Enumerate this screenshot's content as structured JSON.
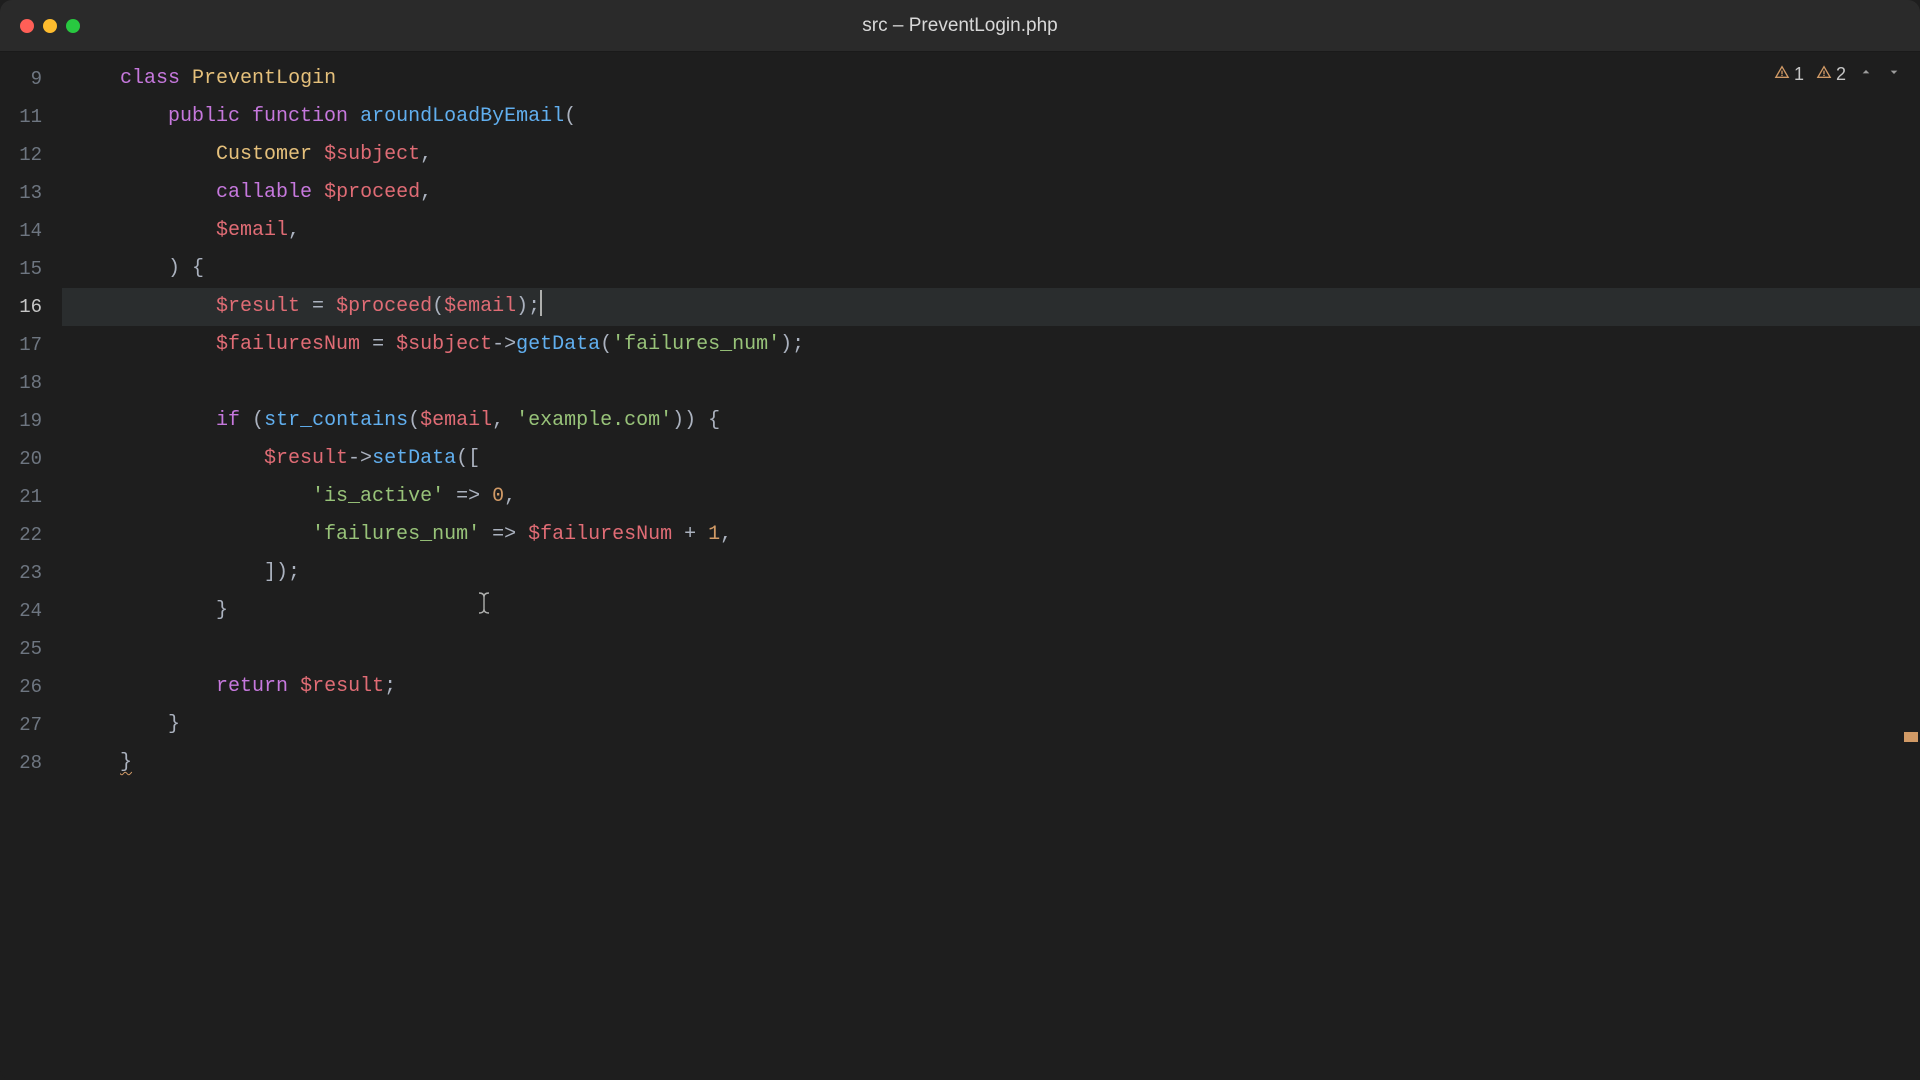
{
  "titlebar": {
    "title": "src – PreventLogin.php"
  },
  "indicators": {
    "warn1_count": "1",
    "warn2_count": "2"
  },
  "gutter": {
    "start": 9,
    "current": 16,
    "lines": [
      "9",
      "11",
      "12",
      "13",
      "14",
      "15",
      "16",
      "17",
      "18",
      "19",
      "20",
      "21",
      "22",
      "23",
      "24",
      "25",
      "26",
      "27",
      "28"
    ]
  },
  "code": {
    "l9": {
      "class_kw": "class",
      "class_name": "PreventLogin"
    },
    "l11": {
      "pub": "public",
      "func": "function",
      "name": "aroundLoadByEmail",
      "paren": "("
    },
    "l12": {
      "type": "Customer",
      "var": "$subject",
      "comma": ","
    },
    "l13": {
      "type": "callable",
      "var": "$proceed",
      "comma": ","
    },
    "l14": {
      "var": "$email",
      "comma": ","
    },
    "l15": {
      "close": ") {"
    },
    "l16": {
      "v1": "$result",
      "eq": " = ",
      "v2": "$proceed",
      "op": "(",
      "v3": "$email",
      "cp": ");"
    },
    "l17": {
      "v1": "$failuresNum",
      "eq": " = ",
      "v2": "$subject",
      "arr": "->",
      "fn": "getData",
      "op": "(",
      "s": "'failures_num'",
      "cp": ");"
    },
    "l19": {
      "if": "if",
      "op": " (",
      "fn": "str_contains",
      "op2": "(",
      "v1": "$email",
      "c": ", ",
      "s": "'example.com'",
      "cp": ")) {"
    },
    "l20": {
      "v1": "$result",
      "arr": "->",
      "fn": "setData",
      "op": "(["
    },
    "l21": {
      "k": "'is_active'",
      "fat": " => ",
      "n": "0",
      "c": ","
    },
    "l22": {
      "k": "'failures_num'",
      "fat": " => ",
      "v": "$failuresNum",
      "plus": " + ",
      "n": "1",
      "c": ","
    },
    "l23": {
      "cp": "]);"
    },
    "l24": {
      "brace": "}"
    },
    "l26": {
      "ret": "return",
      "sp": " ",
      "v": "$result",
      "sc": ";"
    },
    "l27": {
      "brace": "}"
    },
    "l28": {
      "brace": "}"
    }
  }
}
